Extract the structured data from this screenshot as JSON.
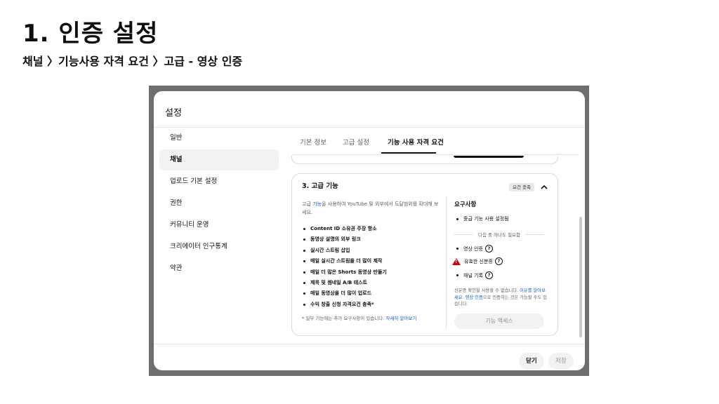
{
  "slide": {
    "title": "1. 인증 설정",
    "subtitle": "채널 〉기능사용 자격 요건 〉고급 - 영상 인증"
  },
  "dialog": {
    "title": "설정",
    "sidebar": [
      {
        "label": "일반",
        "active": false
      },
      {
        "label": "채널",
        "active": true
      },
      {
        "label": "업로드 기본 설정",
        "active": false
      },
      {
        "label": "권한",
        "active": false
      },
      {
        "label": "커뮤니티 운영",
        "active": false
      },
      {
        "label": "크리에이터 인구통계",
        "active": false
      },
      {
        "label": "약관",
        "active": false
      }
    ],
    "tabs": [
      {
        "label": "기본 정보",
        "active": false
      },
      {
        "label": "고급 설정",
        "active": false
      },
      {
        "label": "기능 사용 자격 요건",
        "active": true
      }
    ],
    "card": {
      "title": "3. 고급 기능",
      "badge": "요건 충족",
      "desc_pre": "고급 ",
      "desc_link": "기능",
      "desc_post": "을 사용하여 YouTube 및 외부에서 도달범위를 확대해 보세요.",
      "features": [
        "Content ID 소유권 주장 항소",
        "동영상 설명의 외부 링크",
        "실시간 스트림 삽입",
        "매일 실시간 스트림을 더 많이 제작",
        "매일 더 많은 Shorts 동영상 만들기",
        "제목 및 썸네일 A/B 테스트",
        "매일 동영상을 더 많이 업로드",
        "수익 창출 신청 자격요건 충족*"
      ],
      "note_pre": "* 일부 기능에는 추가 요구사항이 있습니다. ",
      "note_link": "자세히 알아보기",
      "requirements": {
        "title": "요구사항",
        "item1": "중급 기능 사용 설정됨",
        "divider": "다음 중 하나도 필요함",
        "item2": "영상 인증",
        "item3": "유효한 신분증",
        "item4": "채널 기록",
        "foot_pre": "신분증 확인을 사용할 수 없습니다. ",
        "foot_link1": "이유를 알아보세요",
        "foot_mid": ". ",
        "foot_link2": "영상 인증",
        "foot_post": "으로 인증하는 것은 가능할 수도 있습니다.",
        "button": "기능 액세스"
      }
    },
    "footer": {
      "close": "닫기",
      "save": "저장"
    },
    "colors": {
      "link": "#065fd4",
      "warning": "#cc0000"
    }
  }
}
